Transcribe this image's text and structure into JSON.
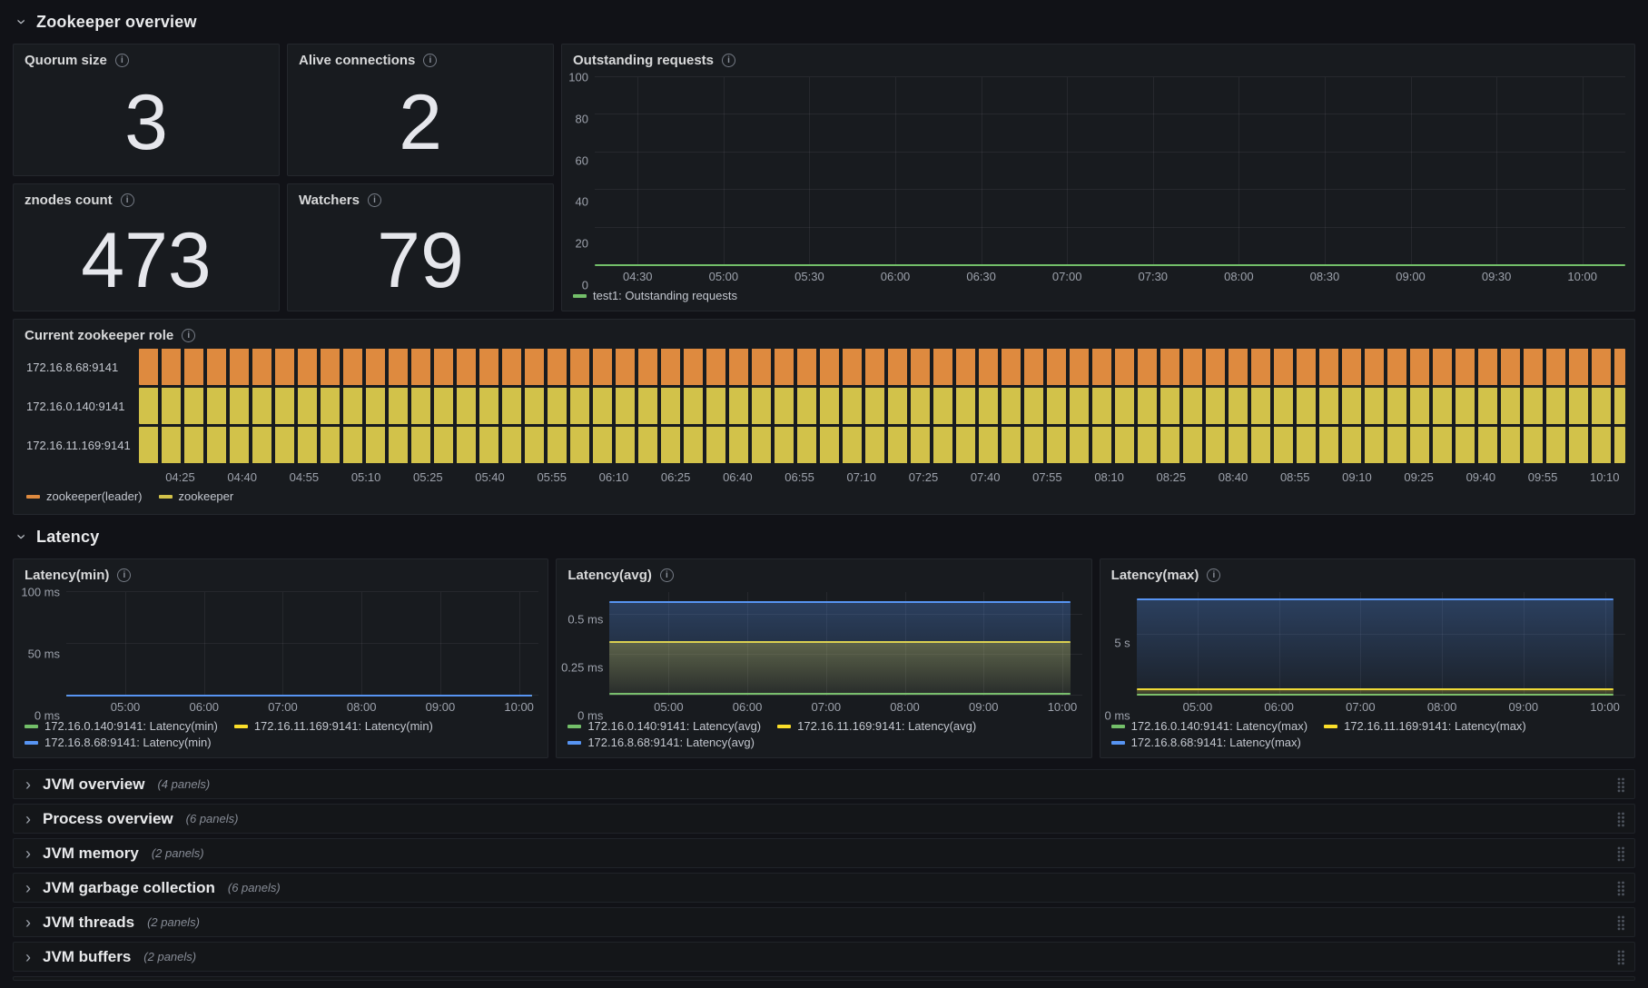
{
  "sections": [
    {
      "title": "Zookeeper overview"
    },
    {
      "title": "Latency"
    }
  ],
  "stat_panels": [
    {
      "title": "Quorum size",
      "value": "3"
    },
    {
      "title": "Alive connections",
      "value": "2"
    },
    {
      "title": "znodes count",
      "value": "473"
    },
    {
      "title": "Watchers",
      "value": "79"
    }
  ],
  "chart_data": {
    "outstanding_requests": {
      "type": "line",
      "title": "Outstanding requests",
      "ylim": [
        0,
        100
      ],
      "y_ticks": [
        {
          "label": "100",
          "value": 100
        },
        {
          "label": "80",
          "value": 80
        },
        {
          "label": "60",
          "value": 60
        },
        {
          "label": "40",
          "value": 40
        },
        {
          "label": "20",
          "value": 20
        },
        {
          "label": "0",
          "value": 0
        }
      ],
      "x_domain": [
        "04:15",
        "10:15"
      ],
      "x_ticks": [
        "04:30",
        "05:00",
        "05:30",
        "06:00",
        "06:30",
        "07:00",
        "07:30",
        "08:00",
        "08:30",
        "09:00",
        "09:30",
        "10:00"
      ],
      "series_end_pct": 100,
      "series": [
        {
          "name": "test1: Outstanding requests",
          "color": "#73BF69",
          "value": 0,
          "fill": false
        }
      ]
    },
    "current_zookeeper_role": {
      "type": "state-timeline",
      "title": "Current zookeeper role",
      "x_domain": [
        "04:15",
        "10:15"
      ],
      "x_ticks": [
        "04:25",
        "04:40",
        "04:55",
        "05:10",
        "05:25",
        "05:40",
        "05:55",
        "06:10",
        "06:25",
        "06:40",
        "06:55",
        "07:10",
        "07:25",
        "07:40",
        "07:55",
        "08:10",
        "08:25",
        "08:40",
        "08:55",
        "09:10",
        "09:25",
        "09:40",
        "09:55",
        "10:10"
      ],
      "rows": [
        {
          "label": "172.16.8.68:9141",
          "state": "zookeeper(leader)",
          "color": "#DE8A3F"
        },
        {
          "label": "172.16.0.140:9141",
          "state": "zookeeper",
          "color": "#D2C24A"
        },
        {
          "label": "172.16.11.169:9141",
          "state": "zookeeper",
          "color": "#D2C24A"
        }
      ],
      "legend": [
        {
          "label": "zookeeper(leader)",
          "color": "#DE8A3F"
        },
        {
          "label": "zookeeper",
          "color": "#D2C24A"
        }
      ]
    },
    "latency_min": {
      "type": "line",
      "title": "Latency(min)",
      "ylim": [
        0,
        100
      ],
      "y_ticks": [
        {
          "label": "100 ms",
          "value": 100
        },
        {
          "label": "50 ms",
          "value": 50
        },
        {
          "label": "0 ms",
          "value": 0
        }
      ],
      "x_domain": [
        "04:15",
        "10:15"
      ],
      "x_ticks": [
        "05:00",
        "06:00",
        "07:00",
        "08:00",
        "09:00",
        "10:00"
      ],
      "series_end_pct": 98.5,
      "series": [
        {
          "name": "172.16.0.140:9141: Latency(min)",
          "color": "#73BF69",
          "value": 0,
          "fill": false
        },
        {
          "name": "172.16.11.169:9141: Latency(min)",
          "color": "#FADE2A",
          "value": 0,
          "fill": false
        },
        {
          "name": "172.16.8.68:9141: Latency(min)",
          "color": "#5794F2",
          "value": 0,
          "fill": false
        }
      ]
    },
    "latency_avg": {
      "type": "line",
      "title": "Latency(avg)",
      "ylim": [
        0,
        0.64
      ],
      "y_ticks": [
        {
          "label": "0.5 ms",
          "value": 0.5
        },
        {
          "label": "0.25 ms",
          "value": 0.25
        },
        {
          "label": "0 ms",
          "value": 0
        }
      ],
      "x_domain": [
        "04:15",
        "10:15"
      ],
      "x_ticks": [
        "05:00",
        "06:00",
        "07:00",
        "08:00",
        "09:00",
        "10:00"
      ],
      "series_end_pct": 97.5,
      "series": [
        {
          "name": "172.16.0.140:9141: Latency(avg)",
          "color": "#73BF69",
          "value": 0.01,
          "fill": false
        },
        {
          "name": "172.16.11.169:9141: Latency(avg)",
          "color": "#FADE2A",
          "value": 0.33,
          "fill": true
        },
        {
          "name": "172.16.8.68:9141: Latency(avg)",
          "color": "#5794F2",
          "value": 0.58,
          "fill": true
        }
      ]
    },
    "latency_max": {
      "type": "line",
      "title": "Latency(max)",
      "ylim": [
        0,
        8.5
      ],
      "y_ticks": [
        {
          "label": "5 s",
          "value": 5
        },
        {
          "label": "0 ms",
          "value": 0
        }
      ],
      "x_domain": [
        "04:15",
        "10:15"
      ],
      "x_ticks": [
        "05:00",
        "06:00",
        "07:00",
        "08:00",
        "09:00",
        "10:00"
      ],
      "series_end_pct": 97.5,
      "series": [
        {
          "name": "172.16.0.140:9141: Latency(max)",
          "color": "#73BF69",
          "value": 0.07,
          "fill": false
        },
        {
          "name": "172.16.11.169:9141: Latency(max)",
          "color": "#FADE2A",
          "value": 0.55,
          "fill": true
        },
        {
          "name": "172.16.8.68:9141: Latency(max)",
          "color": "#5794F2",
          "value": 7.9,
          "fill": true
        }
      ]
    }
  },
  "collapsed_rows": [
    {
      "title": "JVM overview",
      "count": "(4 panels)"
    },
    {
      "title": "Process overview",
      "count": "(6 panels)"
    },
    {
      "title": "JVM memory",
      "count": "(2 panels)"
    },
    {
      "title": "JVM garbage collection",
      "count": "(6 panels)"
    },
    {
      "title": "JVM threads",
      "count": "(2 panels)"
    },
    {
      "title": "JVM buffers",
      "count": "(2 panels)"
    }
  ]
}
